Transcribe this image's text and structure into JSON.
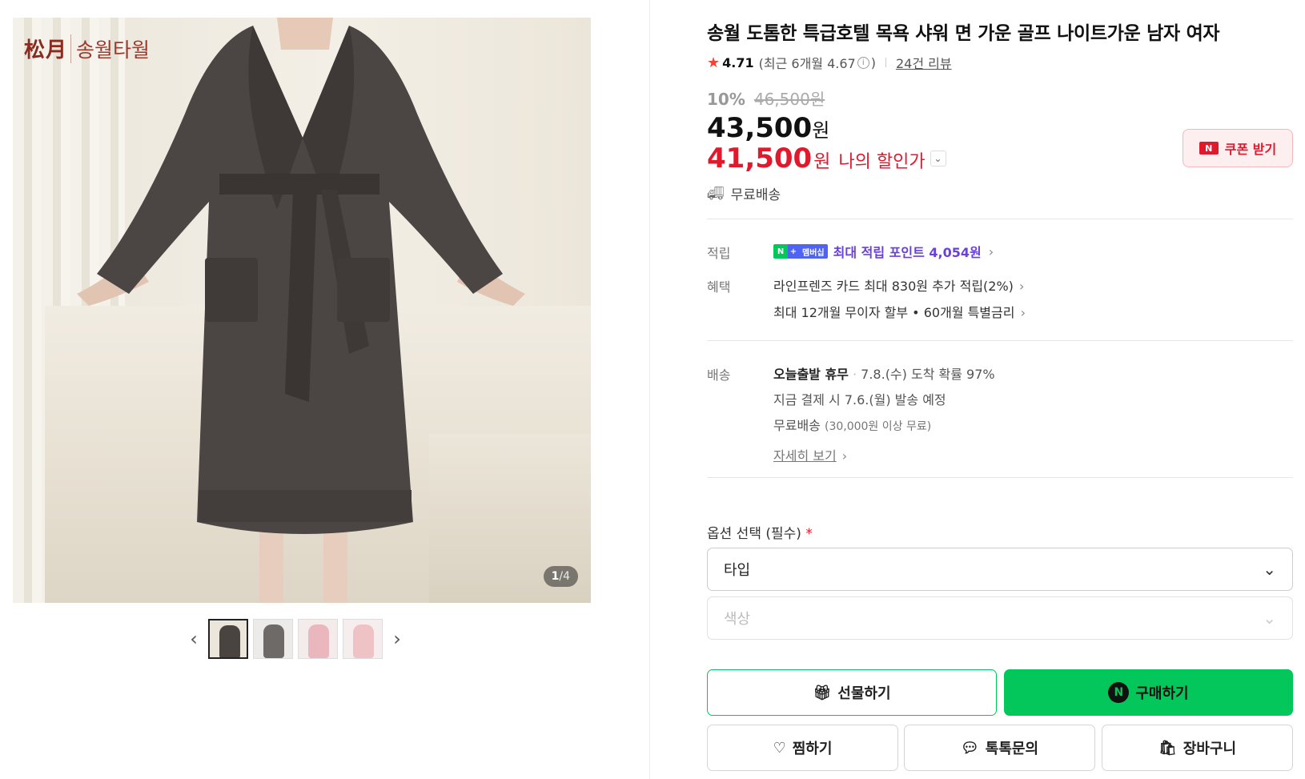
{
  "gallery": {
    "logo_kanji": "松月",
    "logo_brand": "송월타월",
    "counter_current": "1",
    "counter_total": "4",
    "prev_icon": "chevron-left-icon",
    "next_icon": "chevron-right-icon",
    "thumbnails": [
      {
        "color": "#4a4441",
        "active": true
      },
      {
        "color": "#6d6a68",
        "active": false
      },
      {
        "color": "#e9b7bd",
        "active": false
      },
      {
        "color": "#efc2c6",
        "active": false
      }
    ]
  },
  "product": {
    "title": "송월 도톰한 특급호텔 목욕 샤워 면 가운 골프 나이트가운 남자 여자",
    "rating": "4.71",
    "recent_open": "(최근 6개월 4.67",
    "recent_close": ")",
    "review_link": "24건 리뷰",
    "discount_pct": "10%",
    "original_price": "46,500원",
    "price": "43,500",
    "price_unit": "원",
    "my_price": "41,500",
    "my_price_unit": "원",
    "my_price_label": "나의 할인가",
    "coupon_badge": "N",
    "coupon_label": "쿠폰 받기",
    "free_shipping": "무료배송"
  },
  "benefits": {
    "points_label": "적립",
    "np_n": "N",
    "np_plus": "+",
    "np_member": "멤버십",
    "points_text": "최대 적립 포인트 4,054원",
    "benefit_label": "혜택",
    "card_text": "라인프렌즈 카드 최대 830원 추가 적립(2%)",
    "installment_text": "최대 12개월 무이자 할부 • 60개월 특별금리"
  },
  "shipping": {
    "label": "배송",
    "today": "오늘출발 휴무",
    "arrival": "7.8.(수) 도착 확률 97%",
    "dispatch": "지금 결제 시 7.6.(월) 발송 예정",
    "free": "무료배송",
    "free_condition": "(30,000원 이상 무료)",
    "detail_link": "자세히 보기"
  },
  "options": {
    "label": "옵션 선택 (필수)",
    "required_mark": "*",
    "type_select": "타입",
    "color_select": "색상"
  },
  "actions": {
    "gift": "선물하기",
    "buy_badge": "N",
    "buy": "구매하기",
    "wish": "찜하기",
    "talk": "톡톡문의",
    "cart": "장바구니"
  },
  "colors": {
    "naver_green": "#03c75a",
    "sale_red": "#e0192d",
    "points_purple": "#6a3fe0"
  }
}
